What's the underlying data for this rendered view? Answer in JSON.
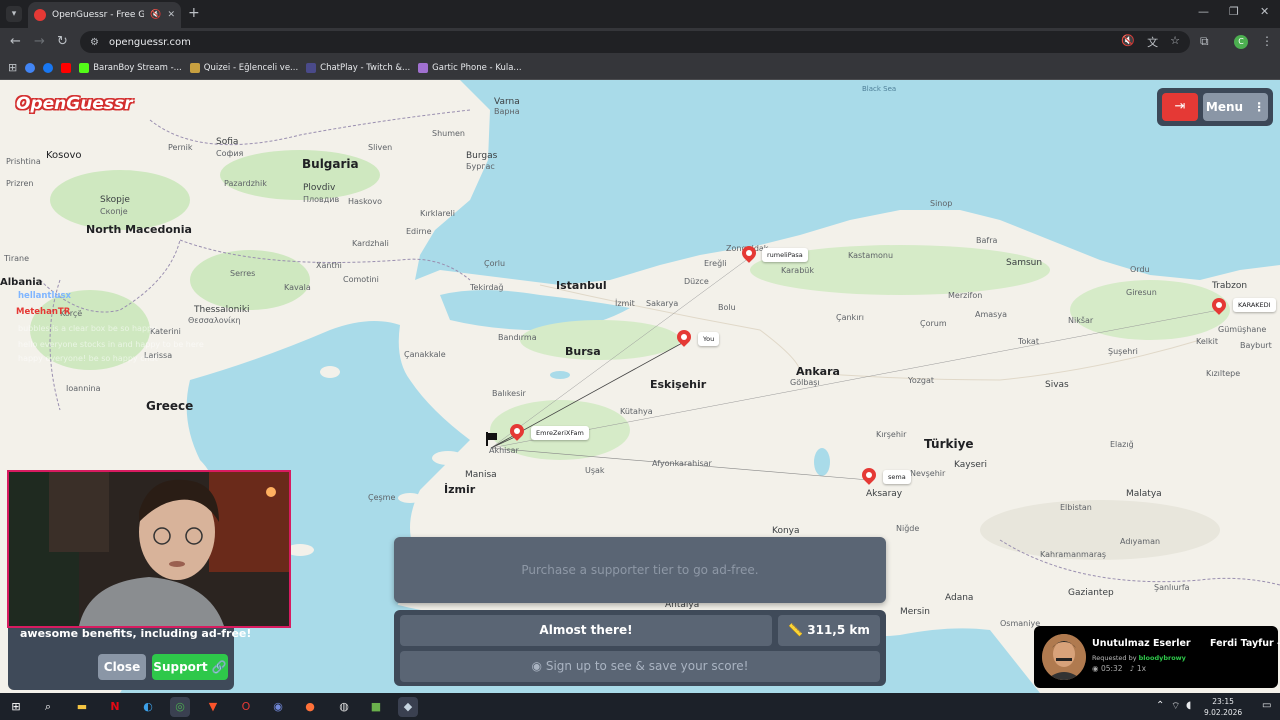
{
  "browser": {
    "tab_title": "OpenGuessr - Free GeoGuessr",
    "url": "openguessr.com",
    "bookmarks": [
      "BaranBoy Stream -...",
      "Quizei - Eğlenceli ve...",
      "ChatPlay - Twitch &...",
      "Gartic Phone - Kula..."
    ],
    "profile_initial": "C"
  },
  "game": {
    "logo": "OpenGuessr",
    "menu_label": "Menu",
    "ad_text": "Purchase a supporter tier to go ad-free.",
    "result_label": "Almost there!",
    "distance": "311,5 km",
    "signup_label": "Sign up to see & save your score!"
  },
  "promo": {
    "text": "awesome benefits, including ad-free!",
    "close_label": "Close",
    "support_label": "Support"
  },
  "pins": [
    {
      "label": "rumeliPasa"
    },
    {
      "label": "You"
    },
    {
      "label": "EmreZeriXFam"
    },
    {
      "label": "sema"
    },
    {
      "label": "KARAKEDI"
    }
  ],
  "chat": {
    "users": [
      "hellantlusx",
      "MetehanTR"
    ],
    "lines": [
      "bubbles is a clear box be so happy",
      "hello everyone stocks in and happy to be here",
      "happy everyone! be so happy chat"
    ]
  },
  "map_labels": {
    "countries": [
      "Bulgaria",
      "North Macedonia",
      "Kosovo",
      "Albania",
      "Greece",
      "Türkiye"
    ],
    "seas": [
      "Black Sea"
    ],
    "cities": [
      "Istanbul",
      "Bursa",
      "Eskişehir",
      "Ankara",
      "İzmir",
      "Konya",
      "Kayseri",
      "Thessaloniki",
      "Θεσσαλονίκη",
      "Sofia",
      "София",
      "Plovdiv",
      "Пловдив",
      "Skopje",
      "Скопје",
      "Varna",
      "Варна",
      "Burgas",
      "Бургас",
      "Samsun",
      "Trabzon",
      "Sivas",
      "Malatya",
      "Gaziantep",
      "Adana",
      "Mersin",
      "Antalya",
      "Manisa",
      "Aksaray",
      "Kütahya",
      "Balıkesir",
      "Çorum",
      "Tokat",
      "Elazığ",
      "Niğde",
      "Yozgat",
      "Kırşehir",
      "Nevşehir",
      "Karabük",
      "Bolu",
      "Zonguldak",
      "Edirne",
      "Tekirdağ",
      "Çanakkale",
      "Bandırma",
      "İzmit",
      "Sakarya",
      "Afyonkarahisar",
      "Uşak",
      "Akhisar",
      "Çeşme",
      "Kahramanmaraş",
      "Adıyaman",
      "Şanlıurfa",
      "Larissa",
      "Ioannina",
      "Tirane",
      "Gümüşhane",
      "Bayburt",
      "Kastamonu",
      "Sinop",
      "Amasya",
      "Ordu",
      "Giresun",
      "Merzifon",
      "Çankırı",
      "Gölbaşı",
      "Nikšar",
      "Şuşehri",
      "Kelkit",
      "Bafra",
      "Ereğli",
      "Düzce",
      "Çorlu",
      "Kavala",
      "Comotini",
      "Xanthi",
      "Serres",
      "Pernik",
      "Sliven",
      "Shumen",
      "Haskovo",
      "Pazardzhik",
      "Kardzhali",
      "Prizren",
      "Prishtina",
      "Korçë",
      "Katerini",
      "Kırklareli",
      "Kızıltepe",
      "Elbistan",
      "Osmaniye"
    ]
  },
  "music": {
    "song": "Unutulmaz Eserler",
    "artist": "Ferdi Tayfur -",
    "requested_by_label": "Requested by",
    "requested_by": "bloodybrowy",
    "time": "05:32",
    "multiplier": "1x"
  },
  "taskbar": {
    "time": "23:15",
    "date": "9.02.2026"
  },
  "colors": {
    "accent_red": "#e53935",
    "support_green": "#2ec84a",
    "panel": "#3f4a59",
    "water": "#a9dbe9",
    "land": "#f3f1ea"
  }
}
